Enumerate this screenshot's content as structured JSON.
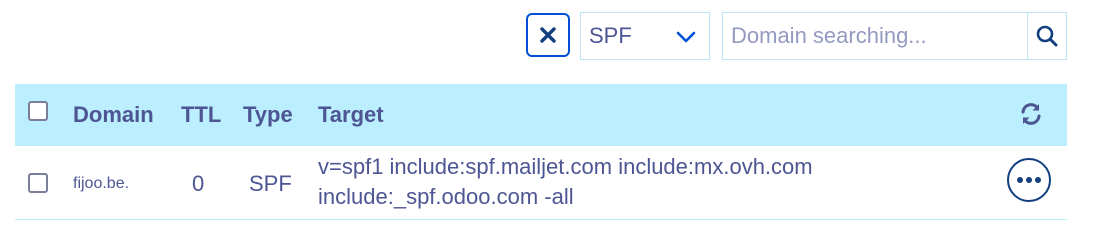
{
  "filter": {
    "clear_icon": "close-icon",
    "record_type_selected": "SPF",
    "search_placeholder": "Domain searching...",
    "search_icon": "search-icon"
  },
  "table": {
    "columns": [
      "Domain",
      "TTL",
      "Type",
      "Target"
    ],
    "refresh_icon": "refresh-icon",
    "rows": [
      {
        "domain": "fijoo.be.",
        "ttl": "0",
        "type": "SPF",
        "target": "v=spf1 include:spf.mailjet.com include:mx.ovh.com include:_spf.odoo.com -all",
        "actions_icon": "more-options-icon"
      }
    ]
  },
  "colors": {
    "header_bg": "#bbeefe",
    "text": "#4d5693",
    "accent": "#0050d7",
    "border": "#bbe5f5"
  }
}
